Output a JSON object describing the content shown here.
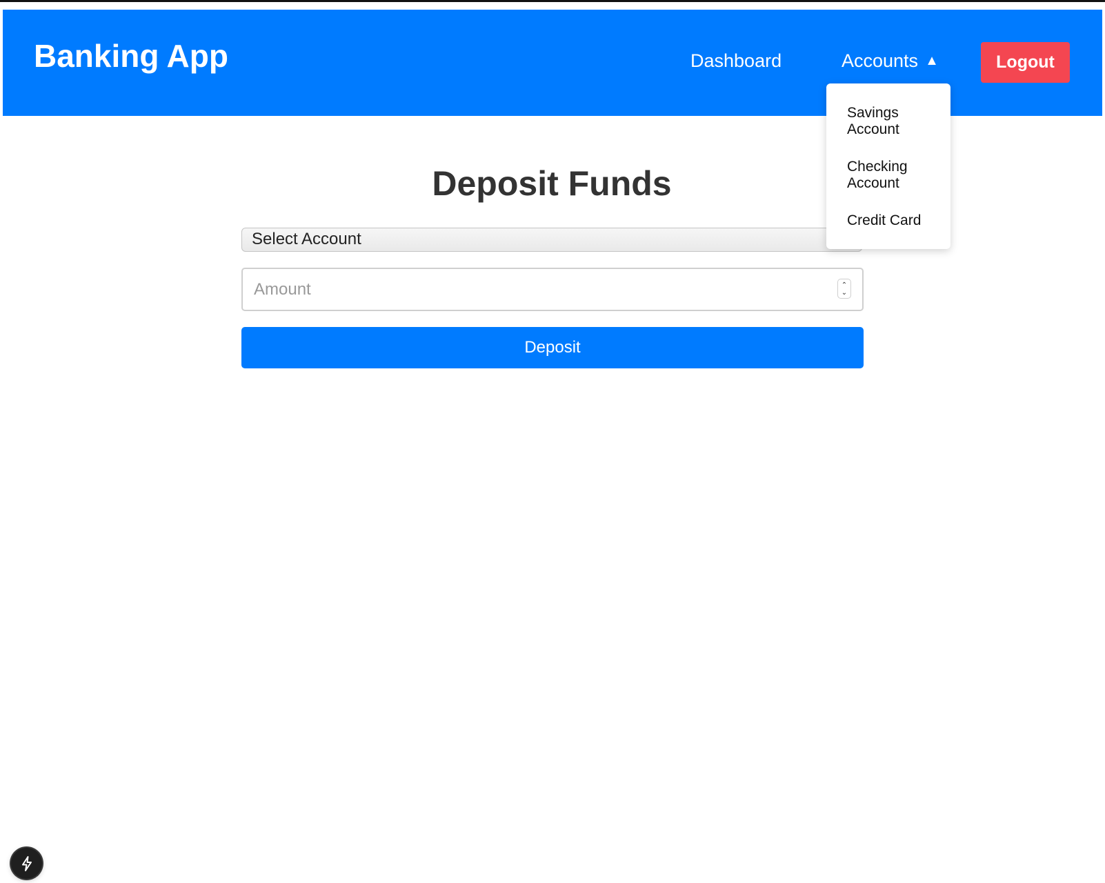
{
  "app": {
    "title": "Banking App"
  },
  "nav": {
    "dashboard_label": "Dashboard",
    "accounts_label": "Accounts",
    "accounts_caret": "▲",
    "logout_label": "Logout"
  },
  "accounts_menu": {
    "items": [
      {
        "label": "Savings Account"
      },
      {
        "label": "Checking Account"
      },
      {
        "label": "Credit Card"
      }
    ]
  },
  "main": {
    "title": "Deposit Funds",
    "account_select": {
      "selected_value": "Select Account"
    },
    "amount_input": {
      "placeholder": "Amount",
      "stepper_up": "⌃",
      "stepper_down": "⌄"
    },
    "deposit_label": "Deposit"
  },
  "devtools": {
    "icon": "lightning-bolt-icon"
  },
  "colors": {
    "navbar": "#007bff",
    "logout": "#f44651",
    "primary_button": "#007bff",
    "title_text": "#333333"
  }
}
